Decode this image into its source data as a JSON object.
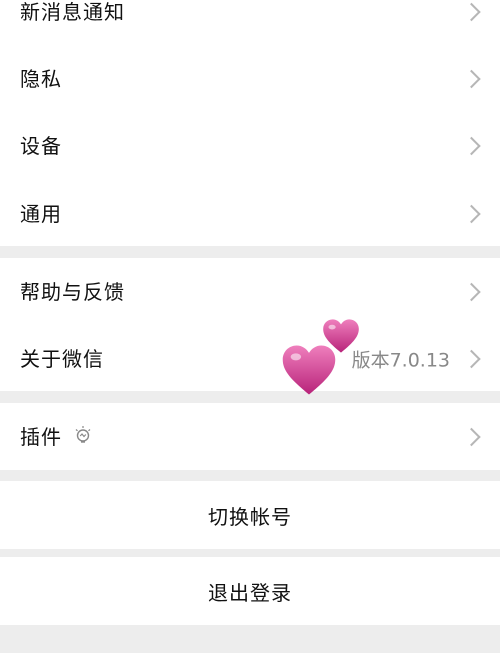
{
  "settings_group_1": {
    "items": [
      {
        "label": "新消息通知"
      },
      {
        "label": "隐私"
      },
      {
        "label": "设备"
      },
      {
        "label": "通用"
      }
    ]
  },
  "settings_group_2": {
    "items": [
      {
        "label": "帮助与反馈"
      },
      {
        "label": "关于微信",
        "value": "版本7.0.13"
      }
    ]
  },
  "settings_group_3": {
    "items": [
      {
        "label": "插件",
        "icon": "lightbulb-icon"
      }
    ]
  },
  "actions": {
    "switch_account": "切换帐号",
    "logout": "退出登录"
  },
  "stickers": [
    "heart-sticker",
    "heart-sticker"
  ],
  "colors": {
    "background": "#ededed",
    "cell": "#ffffff",
    "chevron": "#b6b6b6",
    "secondary_text": "#888888",
    "heart": "#d4418e"
  }
}
